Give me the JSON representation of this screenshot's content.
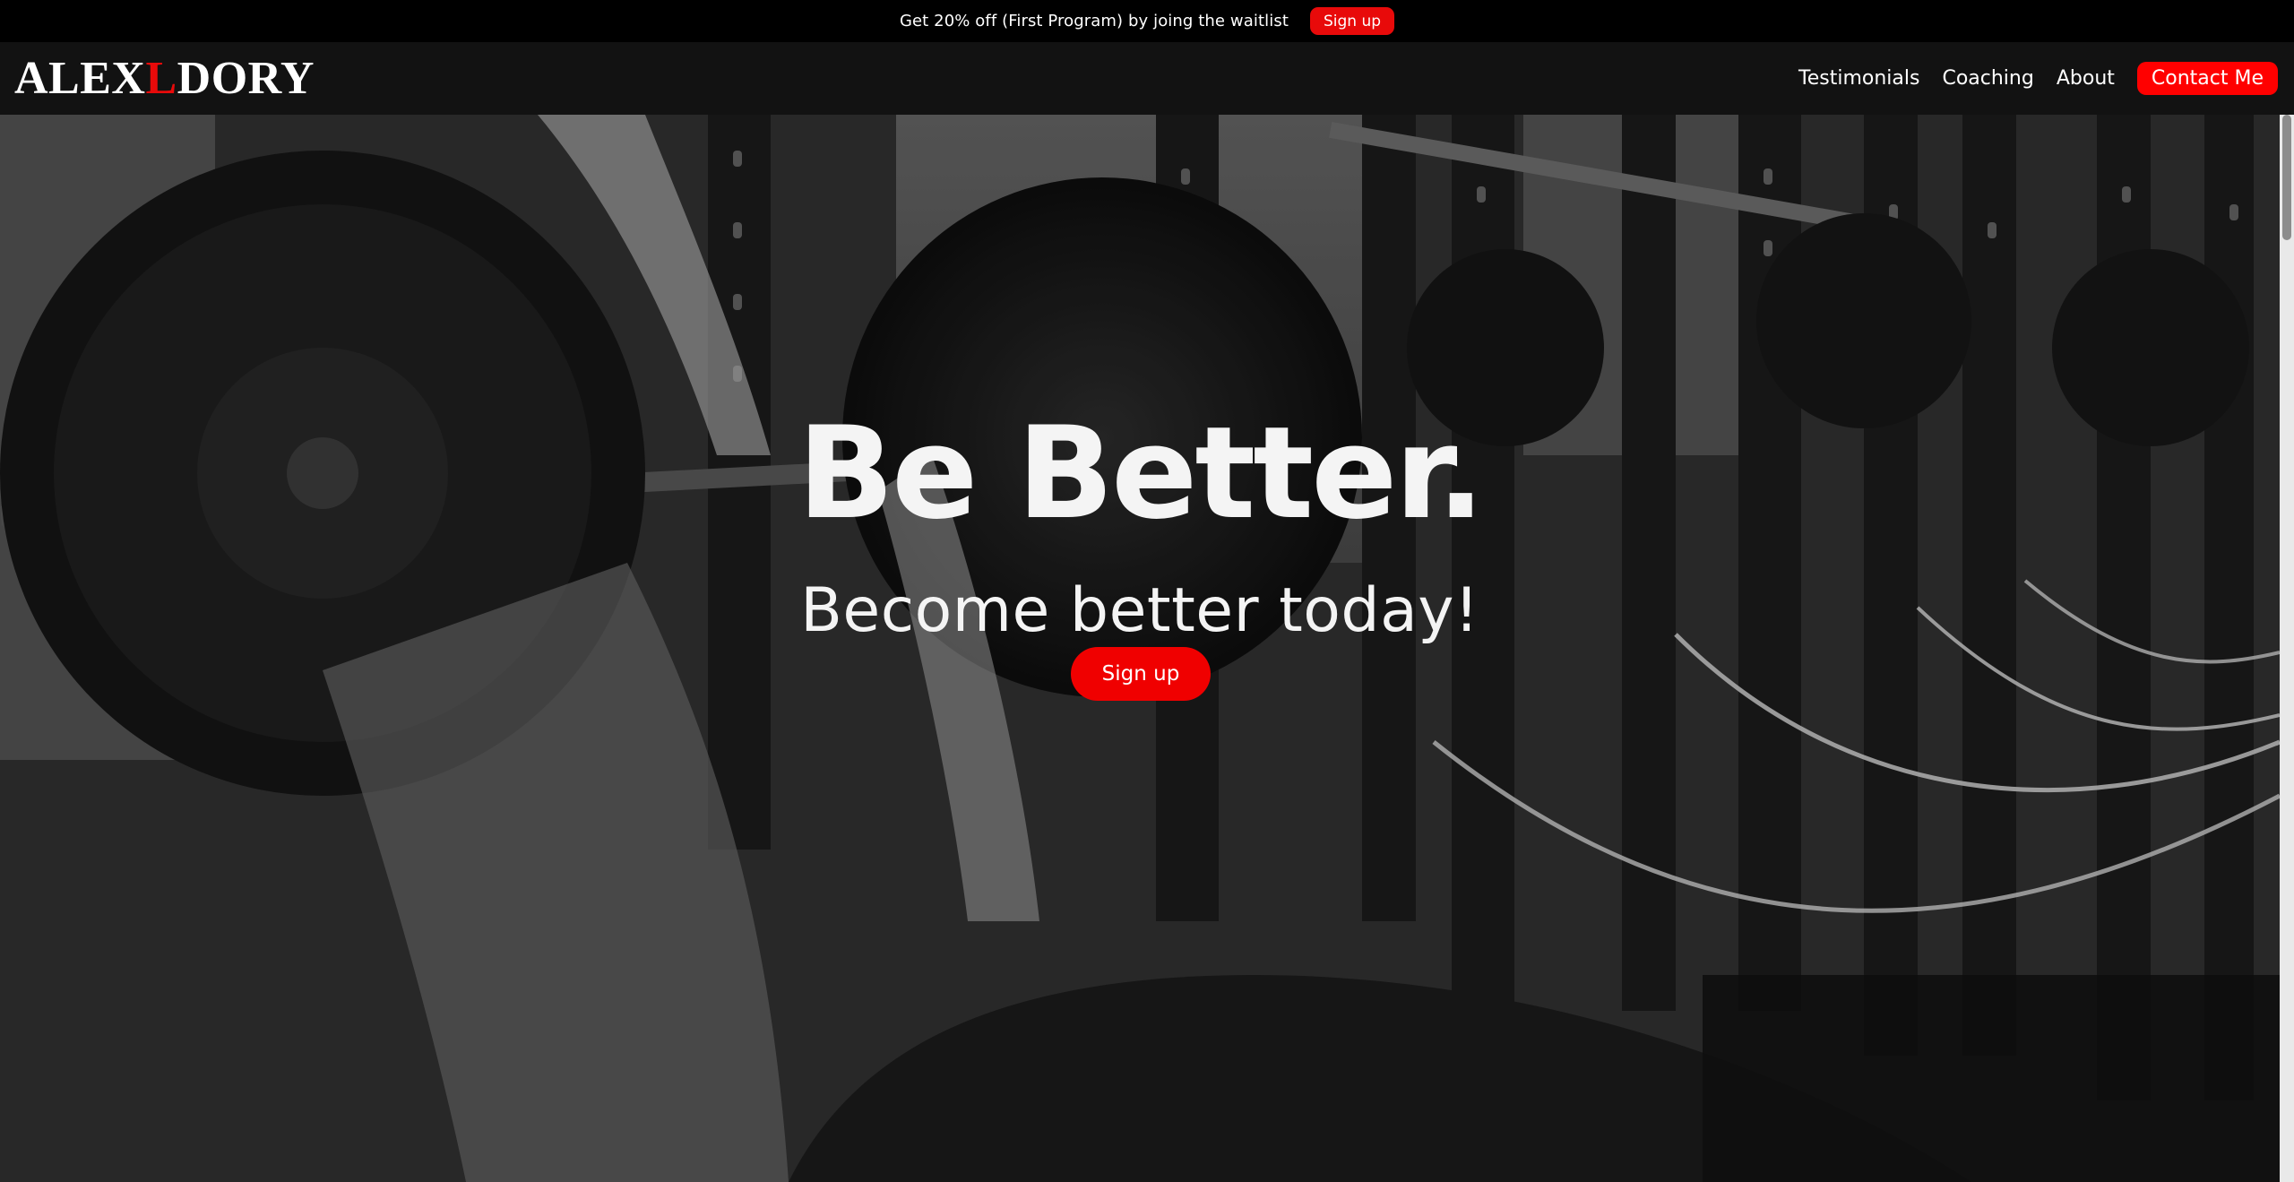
{
  "announcement": {
    "text": "Get 20% off (First Program) by joing the waitlist",
    "button_label": "Sign up"
  },
  "header": {
    "logo": {
      "part1": "ALEX",
      "part2": "L",
      "part3": "DORY"
    },
    "nav": [
      {
        "label": "Testimonials"
      },
      {
        "label": "Coaching"
      },
      {
        "label": "About"
      }
    ],
    "contact_label": "Contact Me"
  },
  "hero": {
    "title": "Be Better.",
    "subtitle": "Become better today!",
    "button_label": "Sign up"
  },
  "colors": {
    "accent": "#e80a0a",
    "header_bg": "#121212",
    "announce_bg": "#000000"
  }
}
